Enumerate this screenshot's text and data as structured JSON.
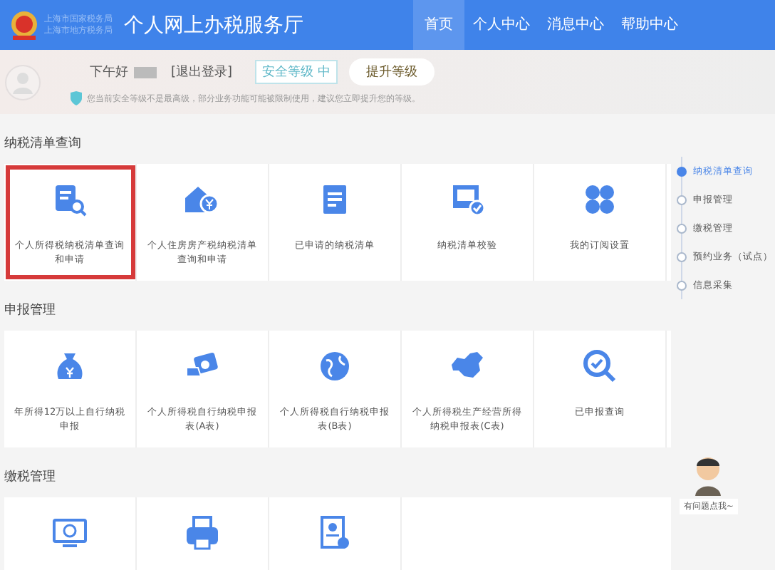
{
  "header": {
    "logo_lines": [
      "上海市国家税务局",
      "上海市地方税务局"
    ],
    "title": "个人网上办税服务厅",
    "nav": [
      {
        "label": "首页",
        "selected": true
      },
      {
        "label": "个人中心",
        "selected": false
      },
      {
        "label": "消息中心",
        "selected": false
      },
      {
        "label": "帮助中心",
        "selected": false
      }
    ]
  },
  "user_bar": {
    "greeting": "下午好",
    "logout": "[退出登录]",
    "security_level": "安全等级 中",
    "upgrade_button": "提升等级",
    "notice": "您当前安全等级不是最高级，部分业务功能可能被限制使用，建议您立即提升您的等级。"
  },
  "sections": [
    {
      "title": "纳税清单查询",
      "cards": [
        {
          "label": "个人所得税纳税清单查询和申请",
          "highlighted": true
        },
        {
          "label": "个人住房房产税纳税清单查询和申请",
          "highlighted": false
        },
        {
          "label": "已申请的纳税清单",
          "highlighted": false
        },
        {
          "label": "纳税清单校验",
          "highlighted": false
        },
        {
          "label": "我的订阅设置",
          "highlighted": false
        }
      ]
    },
    {
      "title": "申报管理",
      "cards": [
        {
          "label": "年所得12万以上自行纳税申报",
          "highlighted": false
        },
        {
          "label": "个人所得税自行纳税申报表(A表)",
          "highlighted": false
        },
        {
          "label": "个人所得税自行纳税申报表(B表)",
          "highlighted": false
        },
        {
          "label": "个人所得税生产经营所得纳税申报表(C表)",
          "highlighted": false
        },
        {
          "label": "已申报查询",
          "highlighted": false
        }
      ]
    },
    {
      "title": "缴税管理",
      "cards": [
        {
          "highlighted": false
        },
        {
          "highlighted": false
        },
        {
          "highlighted": false
        }
      ]
    }
  ],
  "side_nav": [
    {
      "label": "纳税清单查询",
      "selected": true
    },
    {
      "label": "申报管理",
      "selected": false
    },
    {
      "label": "缴税管理",
      "selected": false
    },
    {
      "label": "预约业务（试点）",
      "selected": false
    },
    {
      "label": "信息采集",
      "selected": false
    }
  ],
  "helper": {
    "caption": "有问题点我~"
  }
}
